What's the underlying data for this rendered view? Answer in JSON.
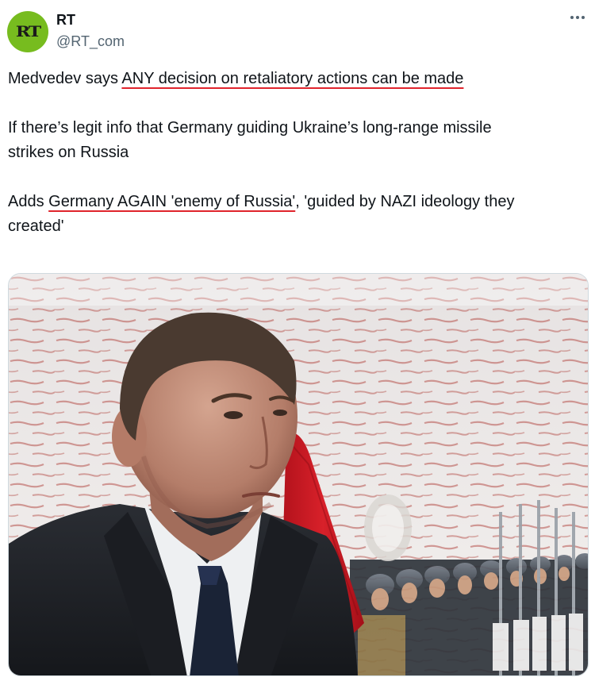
{
  "account": {
    "avatar_icon": "rt-logo-icon",
    "avatar_text": "RT",
    "avatar_color": "#77bc1f",
    "display_name": "RT",
    "handle": "@RT_com"
  },
  "more_icon": "more-horizontal-icon",
  "tweet": {
    "line1_pre": "Medvedev says ",
    "line1_ul": "ANY decision on retaliatory actions can be made",
    "line2": "If there’s legit info that Germany guiding Ukraine’s long-range missile",
    "line3": "strikes on Russia",
    "line4_pre": "Adds ",
    "line4_ul": "Germany AGAIN 'enemy of Russia'",
    "line4_post": ", 'guided by NAZI ideology they",
    "line5": "created'"
  },
  "colors": {
    "underline": "#e0242c",
    "text": "#0f1419",
    "secondary": "#536471"
  },
  "media": {
    "type": "photo",
    "icon": "photo-icon"
  }
}
